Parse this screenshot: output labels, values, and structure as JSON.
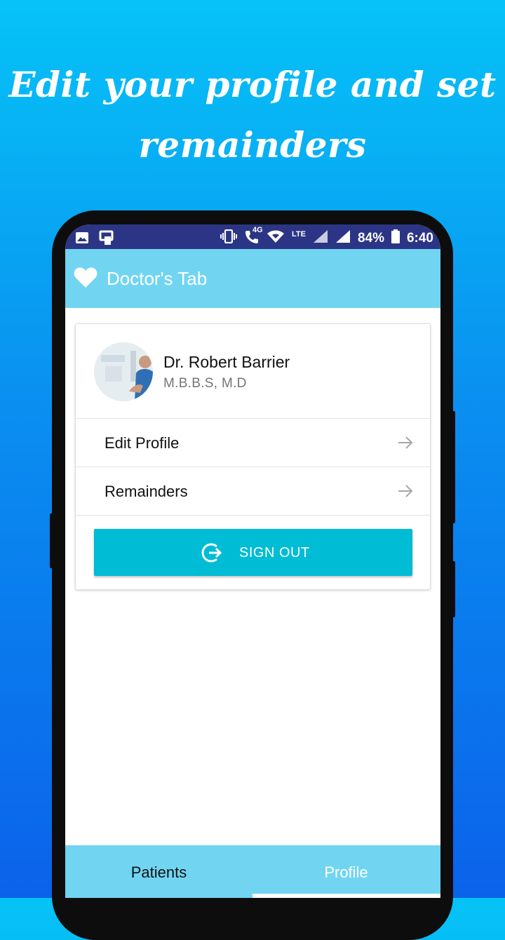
{
  "headline": {
    "line1": "Edit your profile and set",
    "line2": "remainders"
  },
  "status_bar": {
    "network_label": "4G",
    "lte_label": "LTE",
    "battery": "84%",
    "time": "6:40",
    "icons": [
      "image-icon",
      "cast-icon",
      "vibrate-icon",
      "call-4g-icon",
      "wifi-icon",
      "signal-icon",
      "battery-icon"
    ]
  },
  "app_bar": {
    "title": "Doctor's Tab",
    "icon": "heart-icon"
  },
  "profile": {
    "name": "Dr. Robert Barrier",
    "degree": "M.B.B.S, M.D"
  },
  "menu": [
    {
      "label": "Edit Profile",
      "icon": "arrow-right-icon"
    },
    {
      "label": "Remainders",
      "icon": "arrow-right-icon"
    }
  ],
  "sign_out": {
    "label": "SIGN OUT",
    "icon": "logout-icon"
  },
  "bottom_nav": {
    "tabs": [
      {
        "label": "Patients",
        "selected": false
      },
      {
        "label": "Profile",
        "selected": true
      }
    ]
  },
  "colors": {
    "status_bar": "#2c3585",
    "app_bar": "#71d5f2",
    "accent": "#00bcd4",
    "background_top": "#06c3f7",
    "background_bottom": "#0b62ea"
  }
}
